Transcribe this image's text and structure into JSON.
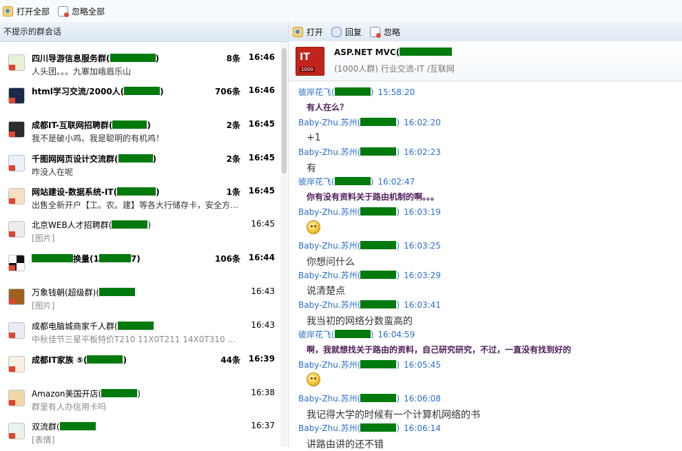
{
  "toolbar": {
    "open_all": "打开全部",
    "ignore_all": "忽略全部"
  },
  "left_panel": {
    "header": "不提示的群会话",
    "items": [
      {
        "name": "四川导游信息服务群(",
        "suffix": ")",
        "subtitle": "人头团。。。九寨加峨眉乐山",
        "count": "8条",
        "time": "16:46",
        "bold": true,
        "icon": "travel-group-icon"
      },
      {
        "name": "html学习交流/2000人(",
        "suffix": ")",
        "subtitle": "",
        "count": "706条",
        "time": "16:46",
        "bold": true,
        "icon": "html-group-icon"
      },
      {
        "name": "成都IT-互联网招聘群(",
        "suffix": ")",
        "subtitle": "我不是破小鸡、我是聪明的有机鸡！",
        "count": "2条",
        "time": "16:45",
        "bold": true,
        "icon": "recruit-group-icon"
      },
      {
        "name": "千图网网页设计交流群(",
        "suffix": ")",
        "subtitle": "咋没人在呢",
        "count": "2条",
        "time": "16:45",
        "bold": true,
        "icon": "design-group-icon"
      },
      {
        "name": "网站建设-数据系统-IT(",
        "suffix": ")",
        "subtitle": "出售全新开户【工。农。建】等各大行储存卡，安全方…",
        "count": "1条",
        "time": "16:45",
        "bold": true,
        "icon": "people-group-icon"
      },
      {
        "name": "北京WEB人才招聘群(",
        "suffix": ")",
        "subtitle": "[图片]",
        "count": "",
        "time": "16:45",
        "bold": false,
        "icon": "web-group-icon"
      },
      {
        "name": "",
        "suffix": "换量(1",
        "suffix2": "7)",
        "subtitle": "",
        "count": "106条",
        "time": "16:44",
        "bold": true,
        "icon": "checker-group-icon"
      },
      {
        "name": "万象钱朝(超级群)(",
        "suffix": "",
        "subtitle": "[图片]",
        "count": "",
        "time": "16:43",
        "bold": false,
        "icon": "portrait-group-icon"
      },
      {
        "name": "成都电脑城商家千人群(",
        "suffix": "",
        "subtitle": "中秋佳节三星平板特价T210      11X0T211      14X0T310      …",
        "count": "",
        "time": "16:43",
        "bold": false,
        "icon": "computer-group-icon"
      },
      {
        "name": "成都IT家族 ⑤(",
        "suffix": ")",
        "subtitle": "",
        "count": "44条",
        "time": "16:39",
        "bold": true,
        "icon": "family-group-icon"
      },
      {
        "name": "Amazon美国开店(",
        "suffix": ")",
        "subtitle": "群里有人办信用卡吗",
        "count": "",
        "time": "16:38",
        "bold": false,
        "icon": "amazon-group-icon"
      },
      {
        "name": "双流群(",
        "suffix": "",
        "subtitle": "[表情]",
        "count": "",
        "time": "16:37",
        "bold": false,
        "icon": "shuangliu-group-icon"
      }
    ]
  },
  "chat": {
    "toolbar": {
      "open": "打开",
      "reply": "回复",
      "ignore": "忽略"
    },
    "group_name": "ASP.NET MVC(",
    "group_info": "(1000人群) 行业交流-IT /互联网",
    "logo_text": "IT",
    "logo_sub": "1000",
    "messages": [
      {
        "sender": "彼岸花飞(",
        "sender_tail": ")",
        "time": "15:58:20",
        "text": "有人在么？",
        "style": "bold"
      },
      {
        "sender": "Baby-Zhu.苏州(",
        "sender_tail": ")",
        "time": "16:02:20",
        "text": "+1",
        "style": "normal"
      },
      {
        "sender": "Baby-Zhu.苏州(",
        "sender_tail": ")",
        "time": "16:02:23",
        "text": "有",
        "style": "normal"
      },
      {
        "sender": "彼岸花飞(",
        "sender_tail": ")",
        "time": "16:02:47",
        "text": "你有没有资料关于路由机制的啊。。。",
        "style": "bold"
      },
      {
        "sender": "Baby-Zhu.苏州(",
        "sender_tail": ")",
        "time": "16:03:19",
        "text": "",
        "style": "emoji"
      },
      {
        "sender": "Baby-Zhu.苏州(",
        "sender_tail": ")",
        "time": "16:03:25",
        "text": "你想问什么",
        "style": "normal"
      },
      {
        "sender": "Baby-Zhu.苏州(",
        "sender_tail": ")",
        "time": "16:03:29",
        "text": "说清楚点",
        "style": "normal"
      },
      {
        "sender": "Baby-Zhu.苏州(",
        "sender_tail": ")",
        "time": "16:03:41",
        "text": "我当初的网络分数蛮高的",
        "style": "normal"
      },
      {
        "sender": "彼岸花飞(",
        "sender_tail": ")",
        "time": "16:04:59",
        "text": "啊，我就想找关于路由的资料，自己研究研究，不过，一直没有找到好的",
        "style": "bold"
      },
      {
        "sender": "Baby-Zhu.苏州(",
        "sender_tail": ")",
        "time": "16:05:45",
        "text": "",
        "style": "emoji"
      },
      {
        "sender": "Baby-Zhu.苏州(",
        "sender_tail": ")",
        "time": "16:06:08",
        "text": "我记得大学的时候有一个计算机网络的书",
        "style": "normal"
      },
      {
        "sender": "Baby-Zhu.苏州(",
        "sender_tail": ")",
        "time": "16:06:14",
        "text": "讲路由讲的还不错",
        "style": "normal"
      }
    ]
  }
}
